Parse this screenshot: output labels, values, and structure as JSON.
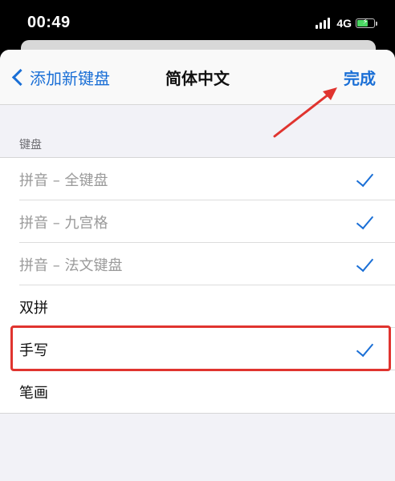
{
  "status_bar": {
    "time": "00:49",
    "network": "4G",
    "battery_level": 0.7,
    "battery_color": "#4cd964"
  },
  "nav": {
    "back_label": "添加新键盘",
    "title": "简体中文",
    "done_label": "完成"
  },
  "section": {
    "header": "键盘"
  },
  "keyboards": [
    {
      "label": "拼音 – 全键盘",
      "checked": true,
      "enabled": false
    },
    {
      "label": "拼音 – 九宫格",
      "checked": true,
      "enabled": false
    },
    {
      "label": "拼音 – 法文键盘",
      "checked": true,
      "enabled": false
    },
    {
      "label": "双拼",
      "checked": false,
      "enabled": true
    },
    {
      "label": "手写",
      "checked": true,
      "enabled": true
    },
    {
      "label": "笔画",
      "checked": false,
      "enabled": true
    }
  ],
  "colors": {
    "accent": "#1a6fd6",
    "annotation": "#e0342f"
  }
}
